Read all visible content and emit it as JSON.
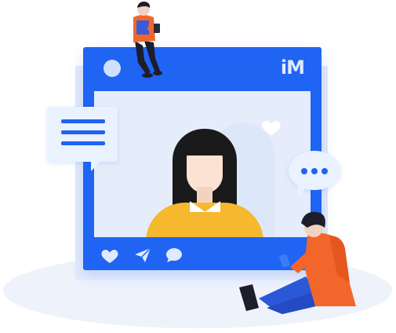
{
  "brand": {
    "logo_text": "iM",
    "primary_color": "#1f64f2",
    "secondary_color": "#e5edfb",
    "accent_color": "#f5b82e",
    "hoodie_color": "#f2662b"
  },
  "window": {
    "icons": [
      "camera-dot-icon",
      "im-logo-icon"
    ]
  },
  "actions": {
    "items": [
      {
        "name": "like",
        "icon": "heart-icon"
      },
      {
        "name": "share",
        "icon": "paper-plane-icon"
      },
      {
        "name": "comment",
        "icon": "chat-bubble-icon"
      }
    ]
  },
  "bubbles": {
    "left": {
      "icon": "text-lines-icon"
    },
    "right": {
      "icon": "ellipsis-icon"
    }
  }
}
